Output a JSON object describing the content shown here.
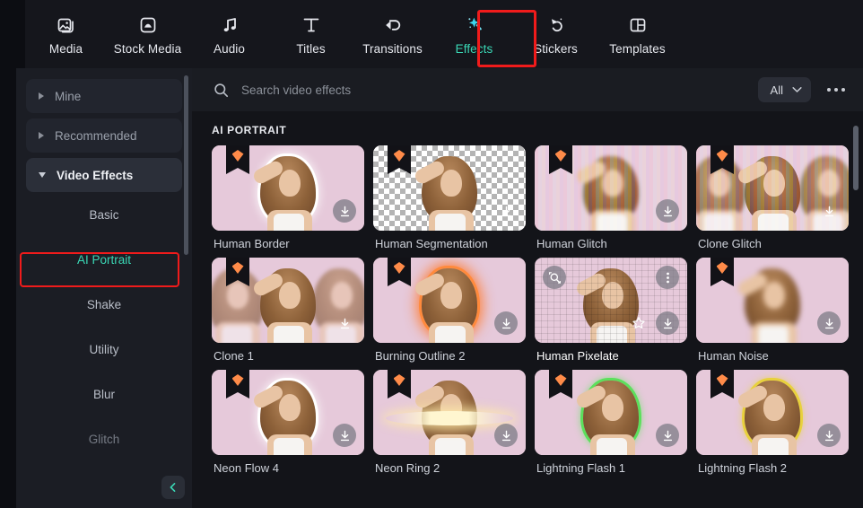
{
  "toolbar": {
    "items": [
      {
        "label": "Media",
        "icon": "media-icon",
        "active": false
      },
      {
        "label": "Stock Media",
        "icon": "stock-media-icon",
        "active": false
      },
      {
        "label": "Audio",
        "icon": "audio-icon",
        "active": false
      },
      {
        "label": "Titles",
        "icon": "titles-icon",
        "active": false
      },
      {
        "label": "Transitions",
        "icon": "transitions-icon",
        "active": false
      },
      {
        "label": "Effects",
        "icon": "effects-icon",
        "active": true
      },
      {
        "label": "Stickers",
        "icon": "stickers-icon",
        "active": false
      },
      {
        "label": "Templates",
        "icon": "templates-icon",
        "active": false
      }
    ],
    "highlight_target": "Effects",
    "highlight_color": "#f01b1b"
  },
  "sidebar": {
    "groups": [
      {
        "label": "Mine",
        "expanded": false
      },
      {
        "label": "Recommended",
        "expanded": false
      },
      {
        "label": "Video Effects",
        "expanded": true
      }
    ],
    "items": [
      {
        "label": "Basic",
        "selected": false,
        "faded": false
      },
      {
        "label": "AI Portrait",
        "selected": true,
        "faded": false
      },
      {
        "label": "Shake",
        "selected": false,
        "faded": false
      },
      {
        "label": "Utility",
        "selected": false,
        "faded": false
      },
      {
        "label": "Blur",
        "selected": false,
        "faded": false
      },
      {
        "label": "Glitch",
        "selected": false,
        "faded": true
      }
    ],
    "selected_highlight_color": "#f01b1b",
    "collapse_icon": "chevron-left-icon",
    "accent_color": "#3ad7b5"
  },
  "search": {
    "placeholder": "Search video effects",
    "value": "",
    "icon": "search-icon",
    "filter_label": "All",
    "filter_icon": "chevron-down-icon",
    "more_icon": "more-horizontal-icon"
  },
  "content": {
    "section_title": "AI PORTRAIT",
    "effects": [
      {
        "name": "Human Border",
        "style": "border",
        "premium": true,
        "hovered": false,
        "download_style": "filled"
      },
      {
        "name": "Human Segmentation",
        "style": "segmentation",
        "premium": true,
        "hovered": false,
        "download_style": "plain"
      },
      {
        "name": "Human Glitch",
        "style": "glitch",
        "premium": true,
        "hovered": false,
        "download_style": "filled"
      },
      {
        "name": "Clone Glitch",
        "style": "clone-glitch",
        "premium": true,
        "hovered": false,
        "download_style": "plain"
      },
      {
        "name": "Clone 1",
        "style": "clone",
        "premium": true,
        "hovered": false,
        "download_style": "plain"
      },
      {
        "name": "Burning Outline 2",
        "style": "burning",
        "premium": true,
        "hovered": false,
        "download_style": "filled"
      },
      {
        "name": "Human Pixelate",
        "style": "pixelate",
        "premium": false,
        "hovered": true,
        "download_style": "filled"
      },
      {
        "name": "Human Noise",
        "style": "noise",
        "premium": true,
        "hovered": false,
        "download_style": "filled"
      },
      {
        "name": "Neon Flow 4",
        "style": "neon-flow",
        "premium": true,
        "hovered": false,
        "download_style": "filled"
      },
      {
        "name": "Neon Ring 2",
        "style": "neon-ring",
        "premium": true,
        "hovered": false,
        "download_style": "filled"
      },
      {
        "name": "Lightning Flash 1",
        "style": "flash-green",
        "premium": true,
        "hovered": false,
        "download_style": "filled"
      },
      {
        "name": "Lightning Flash 2",
        "style": "flash-yellow",
        "premium": true,
        "hovered": false,
        "download_style": "filled"
      }
    ],
    "hover_actions": {
      "preview": "preview-icon",
      "more": "more-vertical-icon",
      "favorite": "star-icon",
      "download": "download-icon"
    },
    "premium_badge_icon": "premium-gem-icon"
  },
  "colors": {
    "app_background": "#0c0d12",
    "toolbar_background": "#15161c",
    "sidebar_background": "#1b1d24",
    "panel_background": "#131419",
    "accent": "#3ad7b5",
    "highlight": "#f01b1b",
    "premium_gem": "#ff8b49"
  }
}
